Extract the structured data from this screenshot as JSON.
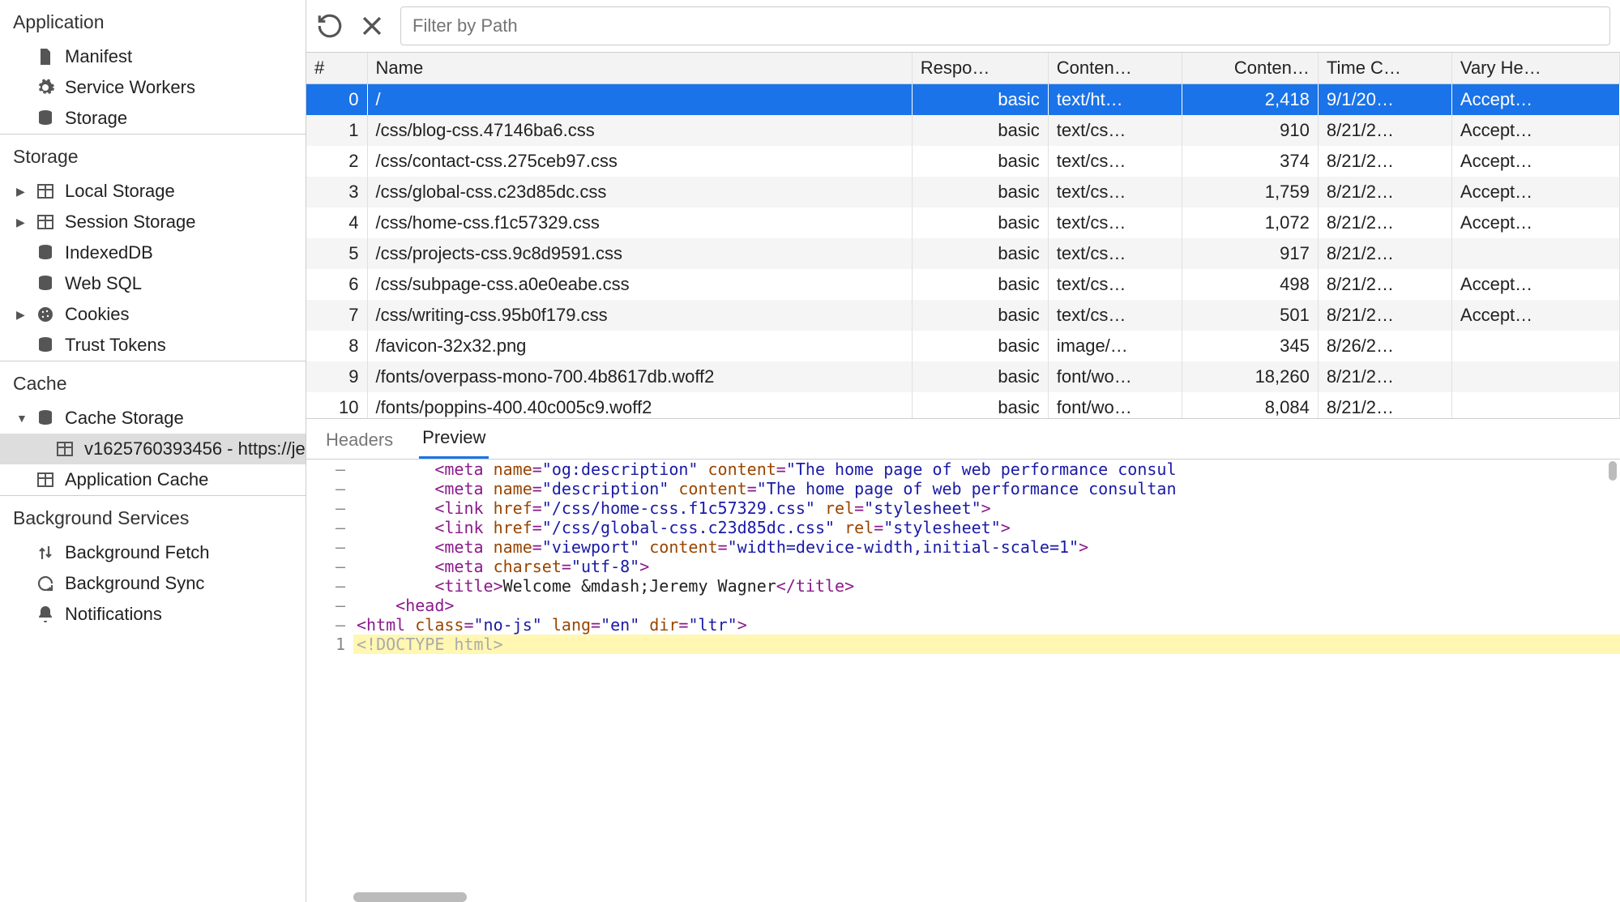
{
  "sidebar": {
    "sections": [
      {
        "heading": "Application",
        "items": [
          {
            "icon": "file-icon",
            "label": "Manifest"
          },
          {
            "icon": "gear-icon",
            "label": "Service Workers"
          },
          {
            "icon": "db-icon",
            "label": "Storage"
          }
        ]
      },
      {
        "heading": "Storage",
        "items": [
          {
            "icon": "table-icon",
            "label": "Local Storage",
            "hasDisclosure": true
          },
          {
            "icon": "table-icon",
            "label": "Session Storage",
            "hasDisclosure": true
          },
          {
            "icon": "db-icon",
            "label": "IndexedDB"
          },
          {
            "icon": "db-icon",
            "label": "Web SQL"
          },
          {
            "icon": "cookie-icon",
            "label": "Cookies",
            "hasDisclosure": true
          },
          {
            "icon": "db-icon",
            "label": "Trust Tokens"
          }
        ]
      },
      {
        "heading": "Cache",
        "items": [
          {
            "icon": "db-icon",
            "label": "Cache Storage",
            "hasDisclosure": true,
            "open": true
          },
          {
            "icon": "table-icon",
            "label": "v1625760393456 - https://je",
            "depth": 2,
            "selected": true
          },
          {
            "icon": "table-icon",
            "label": "Application Cache"
          }
        ]
      },
      {
        "heading": "Background Services",
        "items": [
          {
            "icon": "updown-icon",
            "label": "Background Fetch"
          },
          {
            "icon": "sync-icon",
            "label": "Background Sync"
          },
          {
            "icon": "bell-icon",
            "label": "Notifications"
          }
        ]
      }
    ]
  },
  "toolbar": {
    "filter_placeholder": "Filter by Path"
  },
  "table": {
    "columns": [
      "#",
      "Name",
      "Respo…",
      "Conten…",
      "Conten…",
      "Time C…",
      "Vary He…"
    ],
    "rows": [
      {
        "idx": "0",
        "name": "/",
        "resp": "basic",
        "ctype": "text/ht…",
        "clen": "2,418",
        "time": "9/1/20…",
        "vary": "Accept…",
        "selected": true
      },
      {
        "idx": "1",
        "name": "/css/blog-css.47146ba6.css",
        "resp": "basic",
        "ctype": "text/cs…",
        "clen": "910",
        "time": "8/21/2…",
        "vary": "Accept…"
      },
      {
        "idx": "2",
        "name": "/css/contact-css.275ceb97.css",
        "resp": "basic",
        "ctype": "text/cs…",
        "clen": "374",
        "time": "8/21/2…",
        "vary": "Accept…"
      },
      {
        "idx": "3",
        "name": "/css/global-css.c23d85dc.css",
        "resp": "basic",
        "ctype": "text/cs…",
        "clen": "1,759",
        "time": "8/21/2…",
        "vary": "Accept…"
      },
      {
        "idx": "4",
        "name": "/css/home-css.f1c57329.css",
        "resp": "basic",
        "ctype": "text/cs…",
        "clen": "1,072",
        "time": "8/21/2…",
        "vary": "Accept…"
      },
      {
        "idx": "5",
        "name": "/css/projects-css.9c8d9591.css",
        "resp": "basic",
        "ctype": "text/cs…",
        "clen": "917",
        "time": "8/21/2…",
        "vary": ""
      },
      {
        "idx": "6",
        "name": "/css/subpage-css.a0e0eabe.css",
        "resp": "basic",
        "ctype": "text/cs…",
        "clen": "498",
        "time": "8/21/2…",
        "vary": "Accept…"
      },
      {
        "idx": "7",
        "name": "/css/writing-css.95b0f179.css",
        "resp": "basic",
        "ctype": "text/cs…",
        "clen": "501",
        "time": "8/21/2…",
        "vary": "Accept…"
      },
      {
        "idx": "8",
        "name": "/favicon-32x32.png",
        "resp": "basic",
        "ctype": "image/…",
        "clen": "345",
        "time": "8/26/2…",
        "vary": ""
      },
      {
        "idx": "9",
        "name": "/fonts/overpass-mono-700.4b8617db.woff2",
        "resp": "basic",
        "ctype": "font/wo…",
        "clen": "18,260",
        "time": "8/21/2…",
        "vary": ""
      },
      {
        "idx": "10",
        "name": "/fonts/poppins-400.40c005c9.woff2",
        "resp": "basic",
        "ctype": "font/wo…",
        "clen": "8,084",
        "time": "8/21/2…",
        "vary": ""
      }
    ]
  },
  "detail": {
    "tabs": {
      "headers": "Headers",
      "preview": "Preview"
    },
    "active_tab": "preview",
    "code_lines": [
      {
        "gutter": "1",
        "hl": true,
        "tokens": [
          {
            "t": "doctype",
            "v": "<!DOCTYPE html>"
          }
        ]
      },
      {
        "gutter": "–",
        "indent": 0,
        "tokens": [
          {
            "t": "tag",
            "v": "<html "
          },
          {
            "t": "attr",
            "v": "class"
          },
          {
            "t": "tag",
            "v": "="
          },
          {
            "t": "str",
            "v": "\"no-js\""
          },
          {
            "t": "tag",
            "v": " "
          },
          {
            "t": "attr",
            "v": "lang"
          },
          {
            "t": "tag",
            "v": "="
          },
          {
            "t": "str",
            "v": "\"en\""
          },
          {
            "t": "tag",
            "v": " "
          },
          {
            "t": "attr",
            "v": "dir"
          },
          {
            "t": "tag",
            "v": "="
          },
          {
            "t": "str",
            "v": "\"ltr\""
          },
          {
            "t": "tag",
            "v": ">"
          }
        ]
      },
      {
        "gutter": "–",
        "indent": 1,
        "tokens": [
          {
            "t": "tag",
            "v": "<head>"
          }
        ]
      },
      {
        "gutter": "–",
        "indent": 2,
        "tokens": [
          {
            "t": "tag",
            "v": "<title>"
          },
          {
            "t": "text",
            "v": "Welcome &mdash;Jeremy Wagner"
          },
          {
            "t": "tag",
            "v": "</title>"
          }
        ]
      },
      {
        "gutter": "–",
        "indent": 2,
        "tokens": [
          {
            "t": "tag",
            "v": "<meta "
          },
          {
            "t": "attr",
            "v": "charset"
          },
          {
            "t": "tag",
            "v": "="
          },
          {
            "t": "str",
            "v": "\"utf-8\""
          },
          {
            "t": "tag",
            "v": ">"
          }
        ]
      },
      {
        "gutter": "–",
        "indent": 2,
        "tokens": [
          {
            "t": "tag",
            "v": "<meta "
          },
          {
            "t": "attr",
            "v": "name"
          },
          {
            "t": "tag",
            "v": "="
          },
          {
            "t": "str",
            "v": "\"viewport\""
          },
          {
            "t": "tag",
            "v": " "
          },
          {
            "t": "attr",
            "v": "content"
          },
          {
            "t": "tag",
            "v": "="
          },
          {
            "t": "str",
            "v": "\"width=device-width,initial-scale=1\""
          },
          {
            "t": "tag",
            "v": ">"
          }
        ]
      },
      {
        "gutter": "–",
        "indent": 2,
        "tokens": [
          {
            "t": "tag",
            "v": "<link "
          },
          {
            "t": "attr",
            "v": "href"
          },
          {
            "t": "tag",
            "v": "="
          },
          {
            "t": "str",
            "v": "\"/css/global-css.c23d85dc.css\""
          },
          {
            "t": "tag",
            "v": " "
          },
          {
            "t": "attr",
            "v": "rel"
          },
          {
            "t": "tag",
            "v": "="
          },
          {
            "t": "str",
            "v": "\"stylesheet\""
          },
          {
            "t": "tag",
            "v": ">"
          }
        ]
      },
      {
        "gutter": "–",
        "indent": 2,
        "tokens": [
          {
            "t": "tag",
            "v": "<link "
          },
          {
            "t": "attr",
            "v": "href"
          },
          {
            "t": "tag",
            "v": "="
          },
          {
            "t": "str",
            "v": "\"/css/home-css.f1c57329.css\""
          },
          {
            "t": "tag",
            "v": " "
          },
          {
            "t": "attr",
            "v": "rel"
          },
          {
            "t": "tag",
            "v": "="
          },
          {
            "t": "str",
            "v": "\"stylesheet\""
          },
          {
            "t": "tag",
            "v": ">"
          }
        ]
      },
      {
        "gutter": "–",
        "indent": 2,
        "tokens": [
          {
            "t": "tag",
            "v": "<meta "
          },
          {
            "t": "attr",
            "v": "name"
          },
          {
            "t": "tag",
            "v": "="
          },
          {
            "t": "str",
            "v": "\"description\""
          },
          {
            "t": "tag",
            "v": " "
          },
          {
            "t": "attr",
            "v": "content"
          },
          {
            "t": "tag",
            "v": "="
          },
          {
            "t": "str",
            "v": "\"The home page of web performance consultan"
          }
        ]
      },
      {
        "gutter": "–",
        "indent": 2,
        "tokens": [
          {
            "t": "tag",
            "v": "<meta "
          },
          {
            "t": "attr",
            "v": "name"
          },
          {
            "t": "tag",
            "v": "="
          },
          {
            "t": "str",
            "v": "\"og:description\""
          },
          {
            "t": "tag",
            "v": " "
          },
          {
            "t": "attr",
            "v": "content"
          },
          {
            "t": "tag",
            "v": "="
          },
          {
            "t": "str",
            "v": "\"The home page of web performance consul"
          }
        ]
      }
    ]
  }
}
